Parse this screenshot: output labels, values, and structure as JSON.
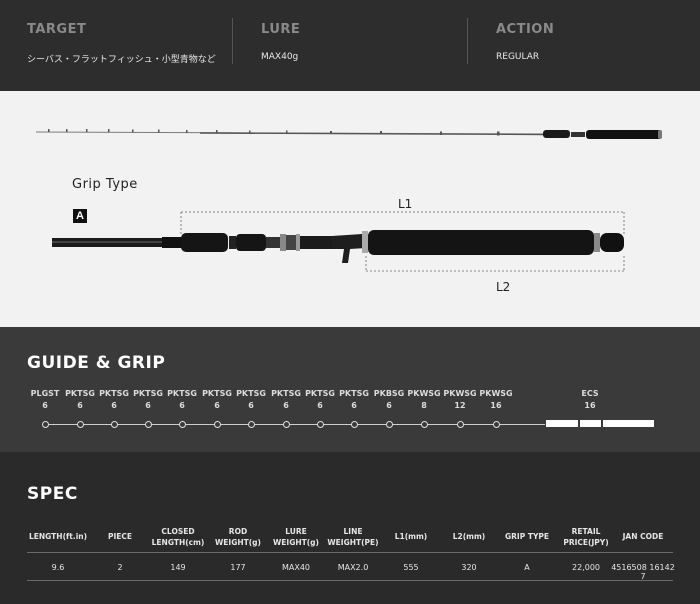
{
  "info": {
    "target": {
      "label": "TARGET",
      "value": "シーバス・フラットフィッシュ・小型青物など"
    },
    "lure": {
      "label": "LURE",
      "value": "MAX40g"
    },
    "action": {
      "label": "ACTION",
      "value": "REGULAR"
    }
  },
  "rod": {
    "grip_type_label": "Grip Type",
    "grip_badge": "A",
    "l1_label": "L1",
    "l2_label": "L2"
  },
  "guide": {
    "title": "GUIDE & GRIP",
    "guides": [
      {
        "name": "PLGST",
        "size": "6"
      },
      {
        "name": "PKTSG",
        "size": "6"
      },
      {
        "name": "PKTSG",
        "size": "6"
      },
      {
        "name": "PKTSG",
        "size": "6"
      },
      {
        "name": "PKTSG",
        "size": "6"
      },
      {
        "name": "PKTSG",
        "size": "6"
      },
      {
        "name": "PKTSG",
        "size": "6"
      },
      {
        "name": "PKTSG",
        "size": "6"
      },
      {
        "name": "PKTSG",
        "size": "6"
      },
      {
        "name": "PKTSG",
        "size": "6"
      },
      {
        "name": "PKBSG",
        "size": "6"
      },
      {
        "name": "PKWSG",
        "size": "8"
      },
      {
        "name": "PKWSG",
        "size": "12"
      },
      {
        "name": "PKWSG",
        "size": "16"
      }
    ],
    "seat": {
      "name": "ECS",
      "size": "16"
    }
  },
  "spec": {
    "title": "SPEC",
    "headers": [
      [
        "LENGTH(ft.in)"
      ],
      [
        "PIECE"
      ],
      [
        "CLOSED",
        "LENGTH(cm)"
      ],
      [
        "ROD",
        "WEIGHT(g)"
      ],
      [
        "LURE",
        "WEIGHT(g)"
      ],
      [
        "LINE",
        "WEIGHT(PE)"
      ],
      [
        "L1(mm)"
      ],
      [
        "L2(mm)"
      ],
      [
        "GRIP TYPE"
      ],
      [
        "RETAIL",
        "PRICE(JPY)"
      ],
      [
        "JAN CODE"
      ]
    ],
    "values": [
      "9.6",
      "2",
      "149",
      "177",
      "MAX40",
      "MAX2.0",
      "555",
      "320",
      "A",
      "22,000",
      "4516508 16142 7"
    ]
  }
}
